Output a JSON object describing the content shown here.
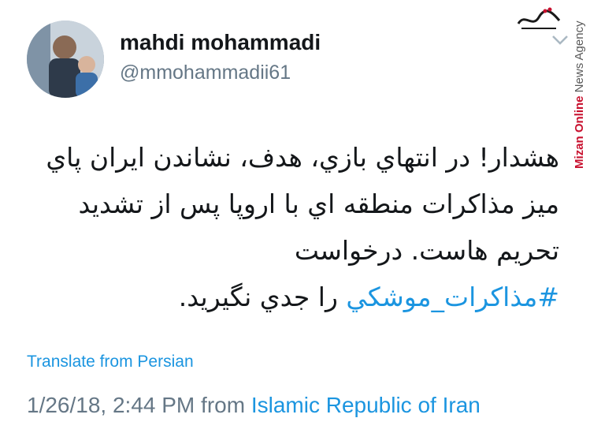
{
  "user": {
    "name": "mahdi mohammadi",
    "handle": "@mmohammadii61"
  },
  "watermark": {
    "brand": "Mizan Online",
    "tagline": "News Agency",
    "logo_text": "میزان خبرگزاری"
  },
  "tweet": {
    "text_before": "هشدار! در انتهاي بازي، هدف، نشاندن ايران پاي ميز مذاكرات منطقه اي با اروپا پس از تشديد تحريم هاست. درخواست",
    "hashtag": "#مذاكرات_موشكي",
    "text_after": "را جدي نگيريد."
  },
  "translate_label": "Translate from Persian",
  "meta": {
    "datetime": "1/26/18, 2:44 PM",
    "from_word": "from",
    "location": "Islamic Republic of Iran"
  },
  "colors": {
    "link": "#1b95e0",
    "secondary_text": "#657786",
    "brand_red": "#c8102e"
  }
}
